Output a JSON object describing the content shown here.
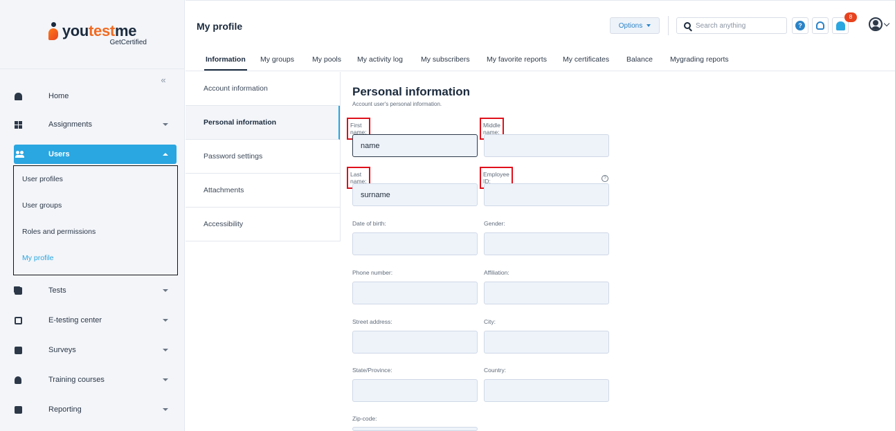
{
  "brand": {
    "name_prefix": "you",
    "name_highlight": "test",
    "name_suffix": "me",
    "tagline": "GetCertified"
  },
  "sidebar": {
    "collapse_glyph": "«",
    "items": [
      {
        "label": "Home",
        "icon": "home-icon"
      },
      {
        "label": "Assignments",
        "icon": "assignments-icon"
      },
      {
        "label": "Users",
        "icon": "users-icon",
        "active": true
      },
      {
        "label": "Tests",
        "icon": "tests-icon"
      },
      {
        "label": "E-testing center",
        "icon": "e-testing-icon"
      },
      {
        "label": "Surveys",
        "icon": "surveys-icon"
      },
      {
        "label": "Training courses",
        "icon": "trophy-icon"
      },
      {
        "label": "Reporting",
        "icon": "reporting-icon"
      }
    ],
    "users_submenu": [
      "User profiles",
      "User groups",
      "Roles and permissions",
      "My profile"
    ]
  },
  "header": {
    "page_title": "My profile",
    "options_label": "Options",
    "search_placeholder": "Search anything",
    "help_glyph": "?",
    "notification_count": "8"
  },
  "tabs": [
    "Information",
    "My groups",
    "My pools",
    "My activity log",
    "My subscribers",
    "My favorite reports",
    "My certificates",
    "Balance",
    "Mygrading reports"
  ],
  "sections": [
    "Account information",
    "Personal information",
    "Password settings",
    "Attachments",
    "Accessibility"
  ],
  "form": {
    "title": "Personal information",
    "subtitle": "Account user's personal information.",
    "info_glyph": "?",
    "fields": {
      "first_name": {
        "label": "First name:",
        "value": "name"
      },
      "middle_name": {
        "label": "Middle name:",
        "value": ""
      },
      "last_name": {
        "label": "Last name:",
        "value": "surname"
      },
      "employee_id": {
        "label": "Employee ID:",
        "value": ""
      },
      "date_of_birth": {
        "label": "Date of birth:",
        "value": ""
      },
      "gender": {
        "label": "Gender:",
        "value": ""
      },
      "phone_number": {
        "label": "Phone number:",
        "value": ""
      },
      "affiliation": {
        "label": "Affiliation:",
        "value": ""
      },
      "street_address": {
        "label": "Street address:",
        "value": ""
      },
      "city": {
        "label": "City:",
        "value": ""
      },
      "state_province": {
        "label": "State/Province:",
        "value": ""
      },
      "country": {
        "label": "Country:",
        "value": ""
      },
      "zip_code": {
        "label": "Zip-code:",
        "value": ""
      }
    }
  },
  "colors": {
    "accent": "#2aa6e0",
    "brand_orange": "#f26a21",
    "highlight_red": "#e0101b",
    "notification": "#e8431f"
  }
}
